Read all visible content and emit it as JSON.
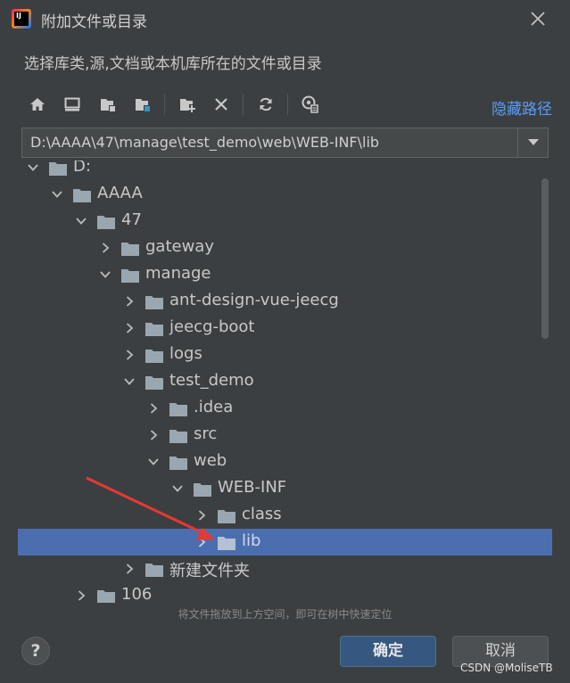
{
  "window": {
    "title": "附加文件或目录",
    "app_icon_text": "IJ"
  },
  "subtitle": "选择库类,源,文档或本机库所在的文件或目录",
  "toolbar": {
    "buttons": [
      "home-icon",
      "desktop-icon",
      "project-folder-icon",
      "module-folder-icon",
      "new-folder-icon",
      "delete-icon",
      "refresh-icon",
      "show-hidden-icon"
    ],
    "hide_path_label": "隐藏路径"
  },
  "path_field": {
    "value": "D:\\AAAA\\47\\manage\\test_demo\\web\\WEB-INF\\lib"
  },
  "tree": {
    "rows": [
      {
        "label": "D:",
        "depth": 0,
        "expanded": true
      },
      {
        "label": "AAAA",
        "depth": 1,
        "expanded": true
      },
      {
        "label": "47",
        "depth": 2,
        "expanded": true
      },
      {
        "label": "gateway",
        "depth": 3,
        "expanded": false
      },
      {
        "label": "manage",
        "depth": 3,
        "expanded": true
      },
      {
        "label": "ant-design-vue-jeecg",
        "depth": 4,
        "expanded": false
      },
      {
        "label": "jeecg-boot",
        "depth": 4,
        "expanded": false
      },
      {
        "label": "logs",
        "depth": 4,
        "expanded": false
      },
      {
        "label": "test_demo",
        "depth": 4,
        "expanded": true
      },
      {
        "label": ".idea",
        "depth": 5,
        "expanded": false
      },
      {
        "label": "src",
        "depth": 5,
        "expanded": false
      },
      {
        "label": "web",
        "depth": 5,
        "expanded": true
      },
      {
        "label": "WEB-INF",
        "depth": 6,
        "expanded": true
      },
      {
        "label": "class",
        "depth": 7,
        "expanded": false
      },
      {
        "label": "lib",
        "depth": 7,
        "expanded": false,
        "selected": true
      },
      {
        "label": "新建文件夹",
        "depth": 4,
        "expanded": false
      },
      {
        "label": "106",
        "depth": 2,
        "expanded": false
      }
    ]
  },
  "hint": "将文件拖放到上方空间，即可在树中快速定位",
  "buttons": {
    "help": "?",
    "ok": "确定",
    "cancel": "取消"
  },
  "watermark": "CSDN @MoliseTB",
  "colors": {
    "accent": "#4b6eaf",
    "link": "#589df6",
    "annotation_arrow": "#e53935"
  }
}
